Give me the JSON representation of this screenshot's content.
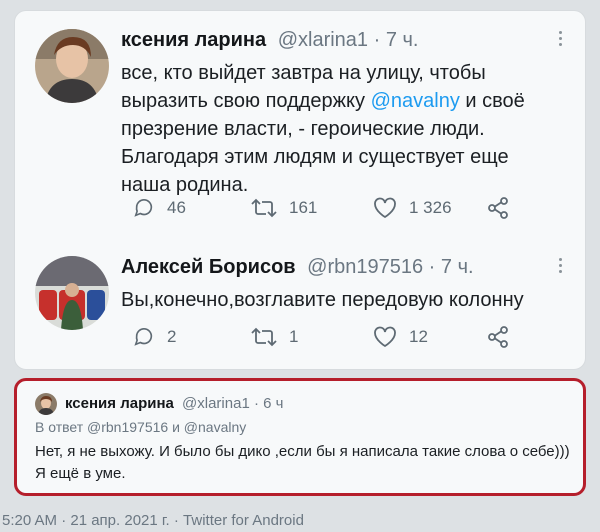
{
  "tweet1": {
    "author_name": "ксения ларина",
    "handle": "@xlarina1",
    "separator": " · ",
    "time": "7 ч.",
    "text_before": "все, кто выйдет завтра на улицу, чтобы выразить свою поддержку ",
    "mention": "@navalny",
    "text_after": " и своё презрение власти, - героические люди. Благодаря этим людям и существует еще наша родина.",
    "replies": "46",
    "retweets": "161",
    "likes": "1 326"
  },
  "tweet2": {
    "author_name": "Алексей Борисов",
    "handle": "@rbn197516",
    "separator": " · ",
    "time": "7 ч.",
    "text": "Вы,конечно,возглавите передовую колонну",
    "replies": "2",
    "retweets": "1",
    "likes": "12"
  },
  "reply": {
    "author_name": "ксения ларина",
    "handle": "@xlarina1",
    "separator": " · ",
    "time": "6 ч",
    "in_reply_to": "В ответ @rbn197516 и @navalny",
    "text": "Нет, я не выхожу. И было бы дико ,если бы я написала такие слова о себе))) Я ещё в уме."
  },
  "footer": {
    "text": "5:20 AM · 21 апр. 2021 г. · Twitter for Android"
  },
  "icons": [
    "more-icon",
    "reply-icon",
    "retweet-icon",
    "like-icon",
    "share-icon"
  ],
  "colors": {
    "mention": "#1d9bf0",
    "highlight_border": "#b51e2b",
    "muted": "#6b7782"
  }
}
